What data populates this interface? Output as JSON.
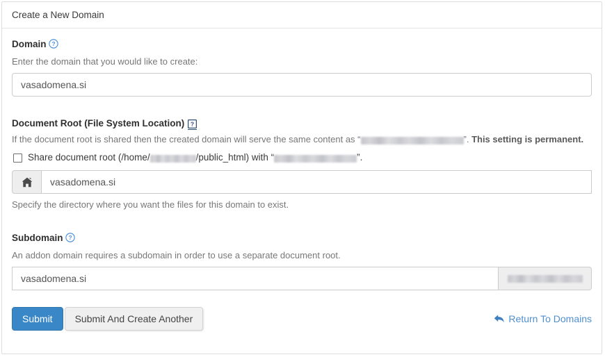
{
  "panel": {
    "title": "Create a New Domain"
  },
  "domain_section": {
    "label": "Domain",
    "help_icon": "question-circle-icon",
    "help_text": "Enter the domain that you would like to create:",
    "input_value": "vasadomena.si",
    "input_placeholder": ""
  },
  "document_root_section": {
    "label": "Document Root (File System Location)",
    "help_icon": "question-square-icon",
    "help_text_prefix": "If the document root is shared then the created domain will serve the same content as “",
    "help_text_redacted": "",
    "help_text_middle": "”. ",
    "help_text_bold": "This setting is permanent.",
    "checkbox_checked": false,
    "checkbox_text_prefix": "Share document root (/home/",
    "checkbox_redacted_user": "",
    "checkbox_text_middle": "/public_html) with “",
    "checkbox_redacted_domain": "",
    "checkbox_text_suffix": "”.",
    "addon_icon": "home-icon",
    "input_value": "vasadomena.si",
    "input_placeholder": "",
    "after_help_text": "Specify the directory where you want the files for this domain to exist."
  },
  "subdomain_section": {
    "label": "Subdomain",
    "help_icon": "question-circle-icon",
    "help_text": "An addon domain requires a subdomain in order to use a separate document root.",
    "input_value": "vasadomena.si",
    "input_placeholder": "",
    "suffix_redacted": ""
  },
  "actions": {
    "submit_label": "Submit",
    "submit_another_label": "Submit And Create Another",
    "return_link_label": "Return To Domains",
    "return_link_icon": "back-arrow-icon"
  },
  "colors": {
    "primary": "#3a87c8",
    "link": "#4f8fd0",
    "help_icon": "#4a90d9",
    "text": "#333333",
    "muted": "#777777",
    "border": "#cccccc",
    "addon_bg": "#eeeeee"
  }
}
